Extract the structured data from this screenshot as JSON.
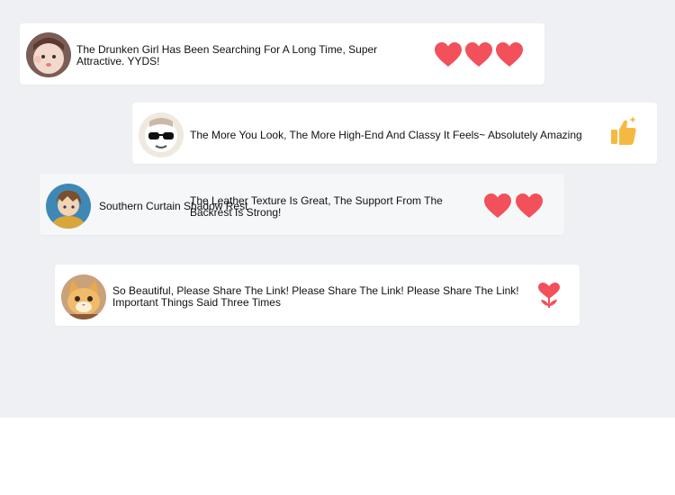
{
  "comments": [
    {
      "text": "The Drunken Girl Has Been Searching For A Long Time, Super Attractive. YYDS!",
      "avatar_icon": "baby-face-avatar",
      "reaction_icons": [
        "heart-icon",
        "heart-icon",
        "heart-icon"
      ]
    },
    {
      "text": "The More You Look, The More High-End And Classy It Feels~ Absolutely Amazing",
      "avatar_icon": "sunglasses-avatar",
      "reaction_icons": [
        "thumbs-up-icon"
      ]
    },
    {
      "user_name": "Southern Curtain Shadow Rest",
      "text": "The Leather Texture Is Great, The Support From The Backrest Is Strong!",
      "avatar_icon": "anime-character-avatar",
      "reaction_icons": [
        "heart-icon",
        "heart-icon"
      ]
    },
    {
      "text": "So Beautiful, Please Share The Link! Please Share The Link! Please Share The Link! Important Things Said Three Times",
      "avatar_icon": "cat-avatar",
      "reaction_icons": [
        "heart-flower-icon"
      ]
    }
  ],
  "colors": {
    "heart": "#f2505a",
    "thumbs_up": "#f5b942",
    "background": "#eef0f3",
    "card": "#ffffff"
  }
}
